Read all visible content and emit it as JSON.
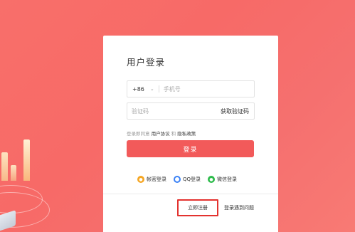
{
  "login": {
    "title": "用户登录",
    "phone": {
      "prefix": "+86",
      "placeholder": "手机号"
    },
    "code": {
      "placeholder": "验证码",
      "get_code_label": "获取验证码"
    },
    "agreement": {
      "prefix": "登录即同意",
      "user_agreement": "用户协议",
      "and": "和",
      "privacy_policy": "隐私政策"
    },
    "login_button": "登录",
    "alt_logins": [
      {
        "label": "帐密登录",
        "icon": "lock-icon",
        "color": "#f5a623"
      },
      {
        "label": "QQ登录",
        "icon": "qq-icon",
        "color": "#3b82f6"
      },
      {
        "label": "微信登录",
        "icon": "wechat-icon",
        "color": "#2dbb4b"
      }
    ],
    "register_button": "立即注册",
    "trouble_link": "登录遇到问题"
  },
  "colors": {
    "background": "#f76a67",
    "primary_button": "#f25a5a",
    "highlight_border": "#e3322f"
  }
}
